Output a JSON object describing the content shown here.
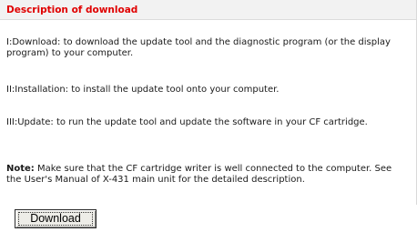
{
  "panel": {
    "title": "Description of download",
    "steps": [
      "I:Download: to download the update tool and the diagnostic program (or the display program) to your computer.",
      "II:Installation: to install the update tool onto your computer.",
      "III:Update: to run the update tool and update the software in your CF cartridge."
    ],
    "note_label": "Note:",
    "note_text": " Make sure that the CF cartridge writer is well connected to the computer. See the User's Manual of X-431 main unit for the detailed description."
  },
  "download_button": {
    "label": "Download"
  },
  "colors": {
    "title": "#e00000",
    "header_bg": "#f2f2f2"
  }
}
